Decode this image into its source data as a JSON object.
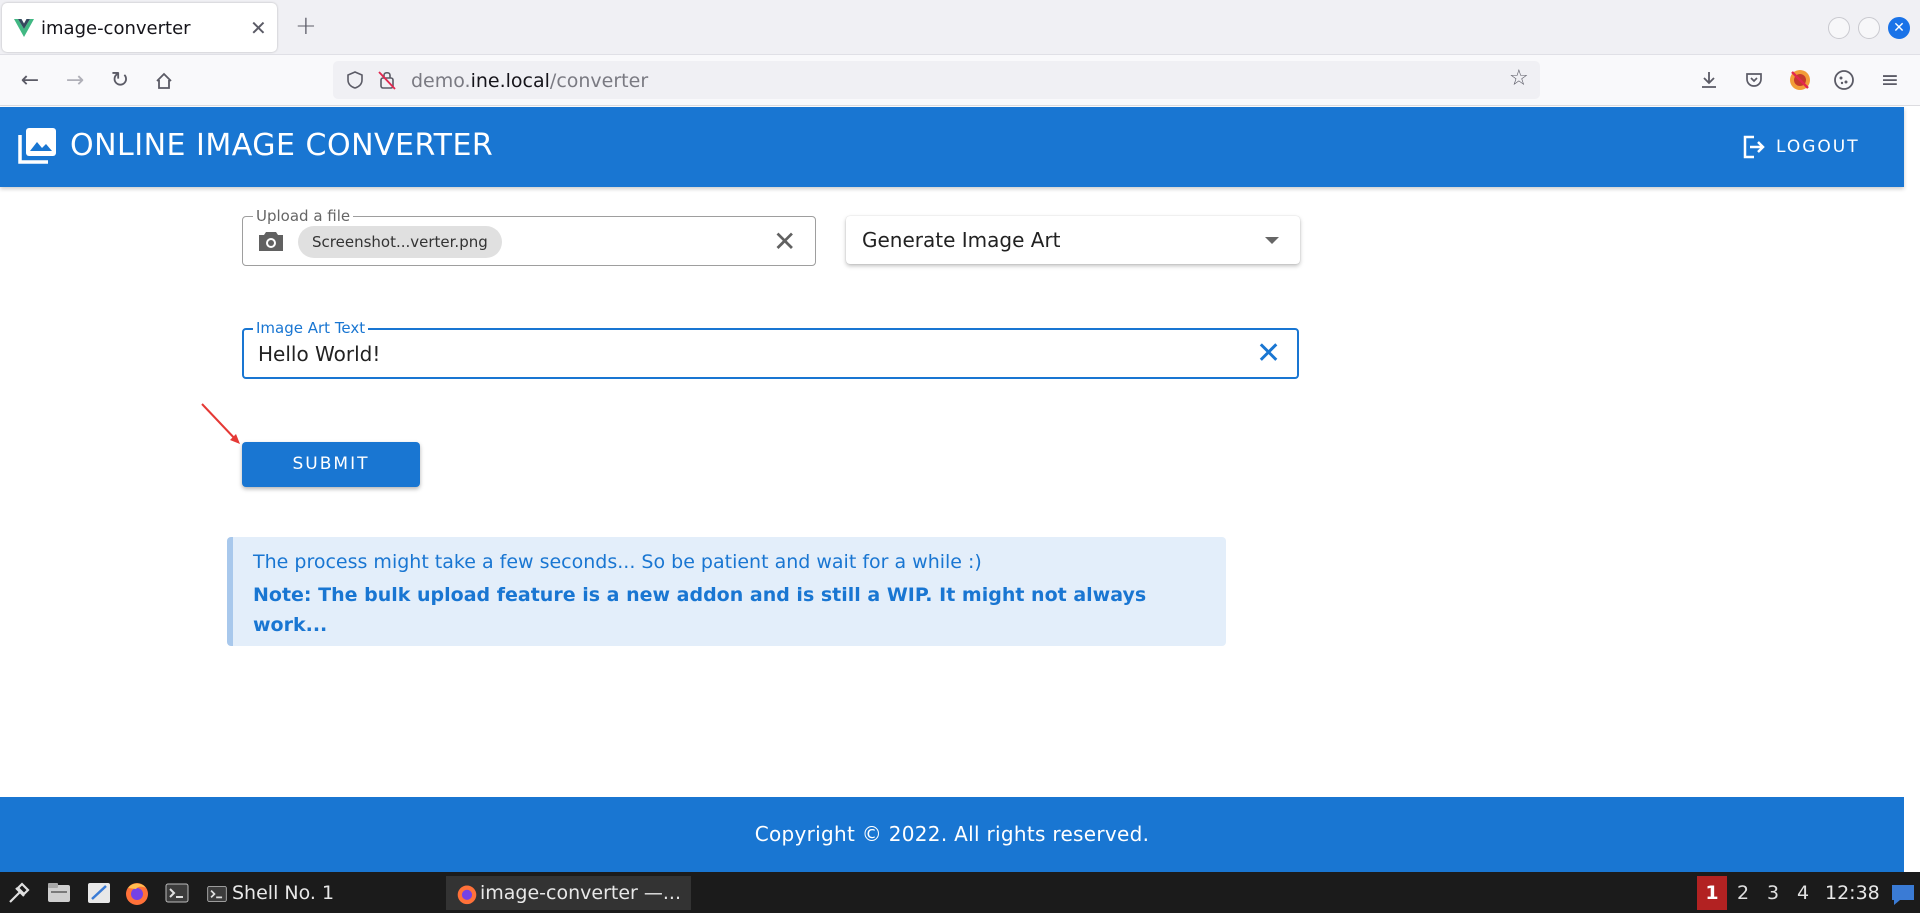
{
  "browser": {
    "tab_title": "image-converter",
    "new_tab": "+",
    "url_domain_pre": "demo.",
    "url_domain_main": "ine.local",
    "url_path": "/converter"
  },
  "app": {
    "title": "ONLINE IMAGE CONVERTER",
    "logout_label": "LOGOUT"
  },
  "form": {
    "upload_label": "Upload a file",
    "upload_file_chip": "Screenshot...verter.png",
    "select_value": "Generate Image Art",
    "art_text_label": "Image Art Text",
    "art_text_value": "Hello World!",
    "submit_label": "SUBMIT"
  },
  "alert": {
    "line1": "The process might take a few seconds... So be patient and wait for a while :)",
    "line2": "Note: The bulk upload feature is a new addon and is still a WIP. It might not always work..."
  },
  "footer": {
    "copyright": "Copyright © 2022. All rights reserved."
  },
  "taskbar": {
    "task1": "Shell No. 1",
    "task2": "image-converter —...",
    "workspaces": [
      "1",
      "2",
      "3",
      "4"
    ],
    "clock": "12:38"
  },
  "colors": {
    "primary": "#1976d2",
    "alert_bg": "#e3eefa"
  }
}
